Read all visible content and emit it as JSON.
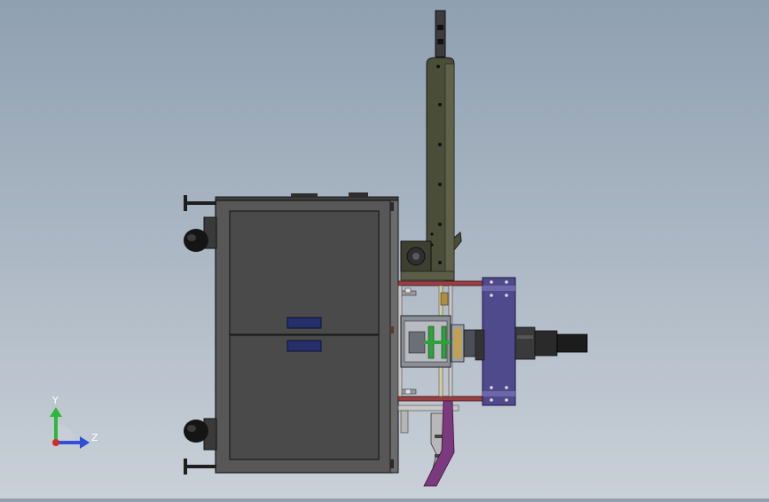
{
  "viewport": {
    "background_top": "#8fa0b1",
    "background_bottom": "#c9d0d8"
  },
  "triad": {
    "y_label": "Y",
    "z_label": "Z",
    "y_color": "#2db83a",
    "z_color": "#2f4fd6",
    "x_color": "#d42a2a"
  },
  "model": {
    "cabinet_color": "#575757",
    "panel_color": "#4a4a4a",
    "arm_color": "#4a4e38",
    "frame_color": "#9a3f43",
    "plate_color": "#4e4a8c",
    "bracket_color": "#7a3a7d",
    "handle_color": "#25306b"
  }
}
